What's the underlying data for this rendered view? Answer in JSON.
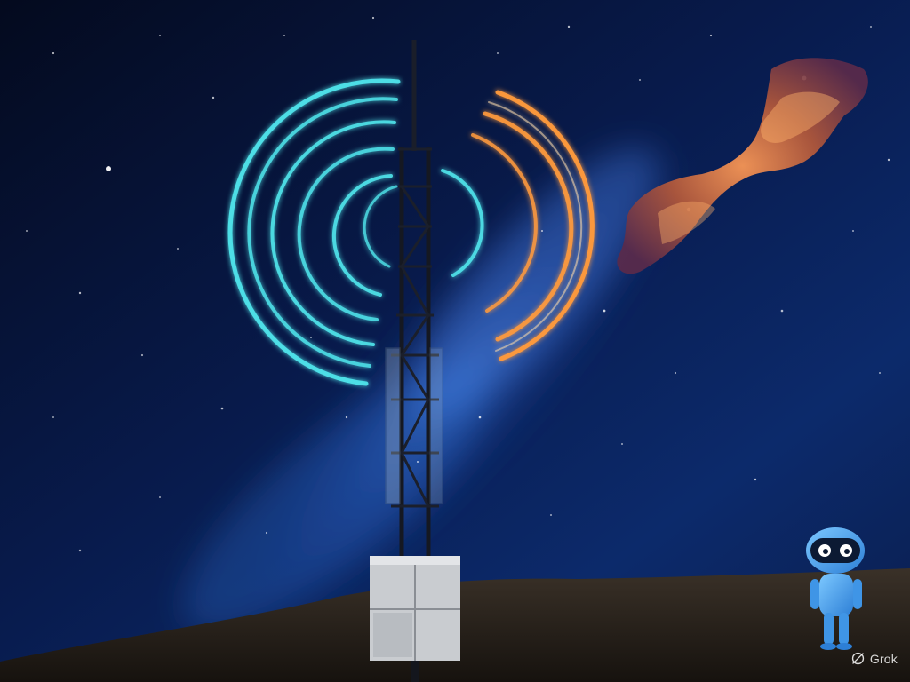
{
  "watermark": {
    "text": "Grok",
    "icon": "grok-logo-icon"
  },
  "colors": {
    "sky_deep": "#050d24",
    "sky_mid": "#0b2a6e",
    "milky_way": "#2f6fd8",
    "wave_left": "#4fe3ea",
    "wave_right": "#ff9a3c",
    "nebula": "#b5593a",
    "robot_body": "#4aa6f2",
    "ground": "#2a241f"
  }
}
